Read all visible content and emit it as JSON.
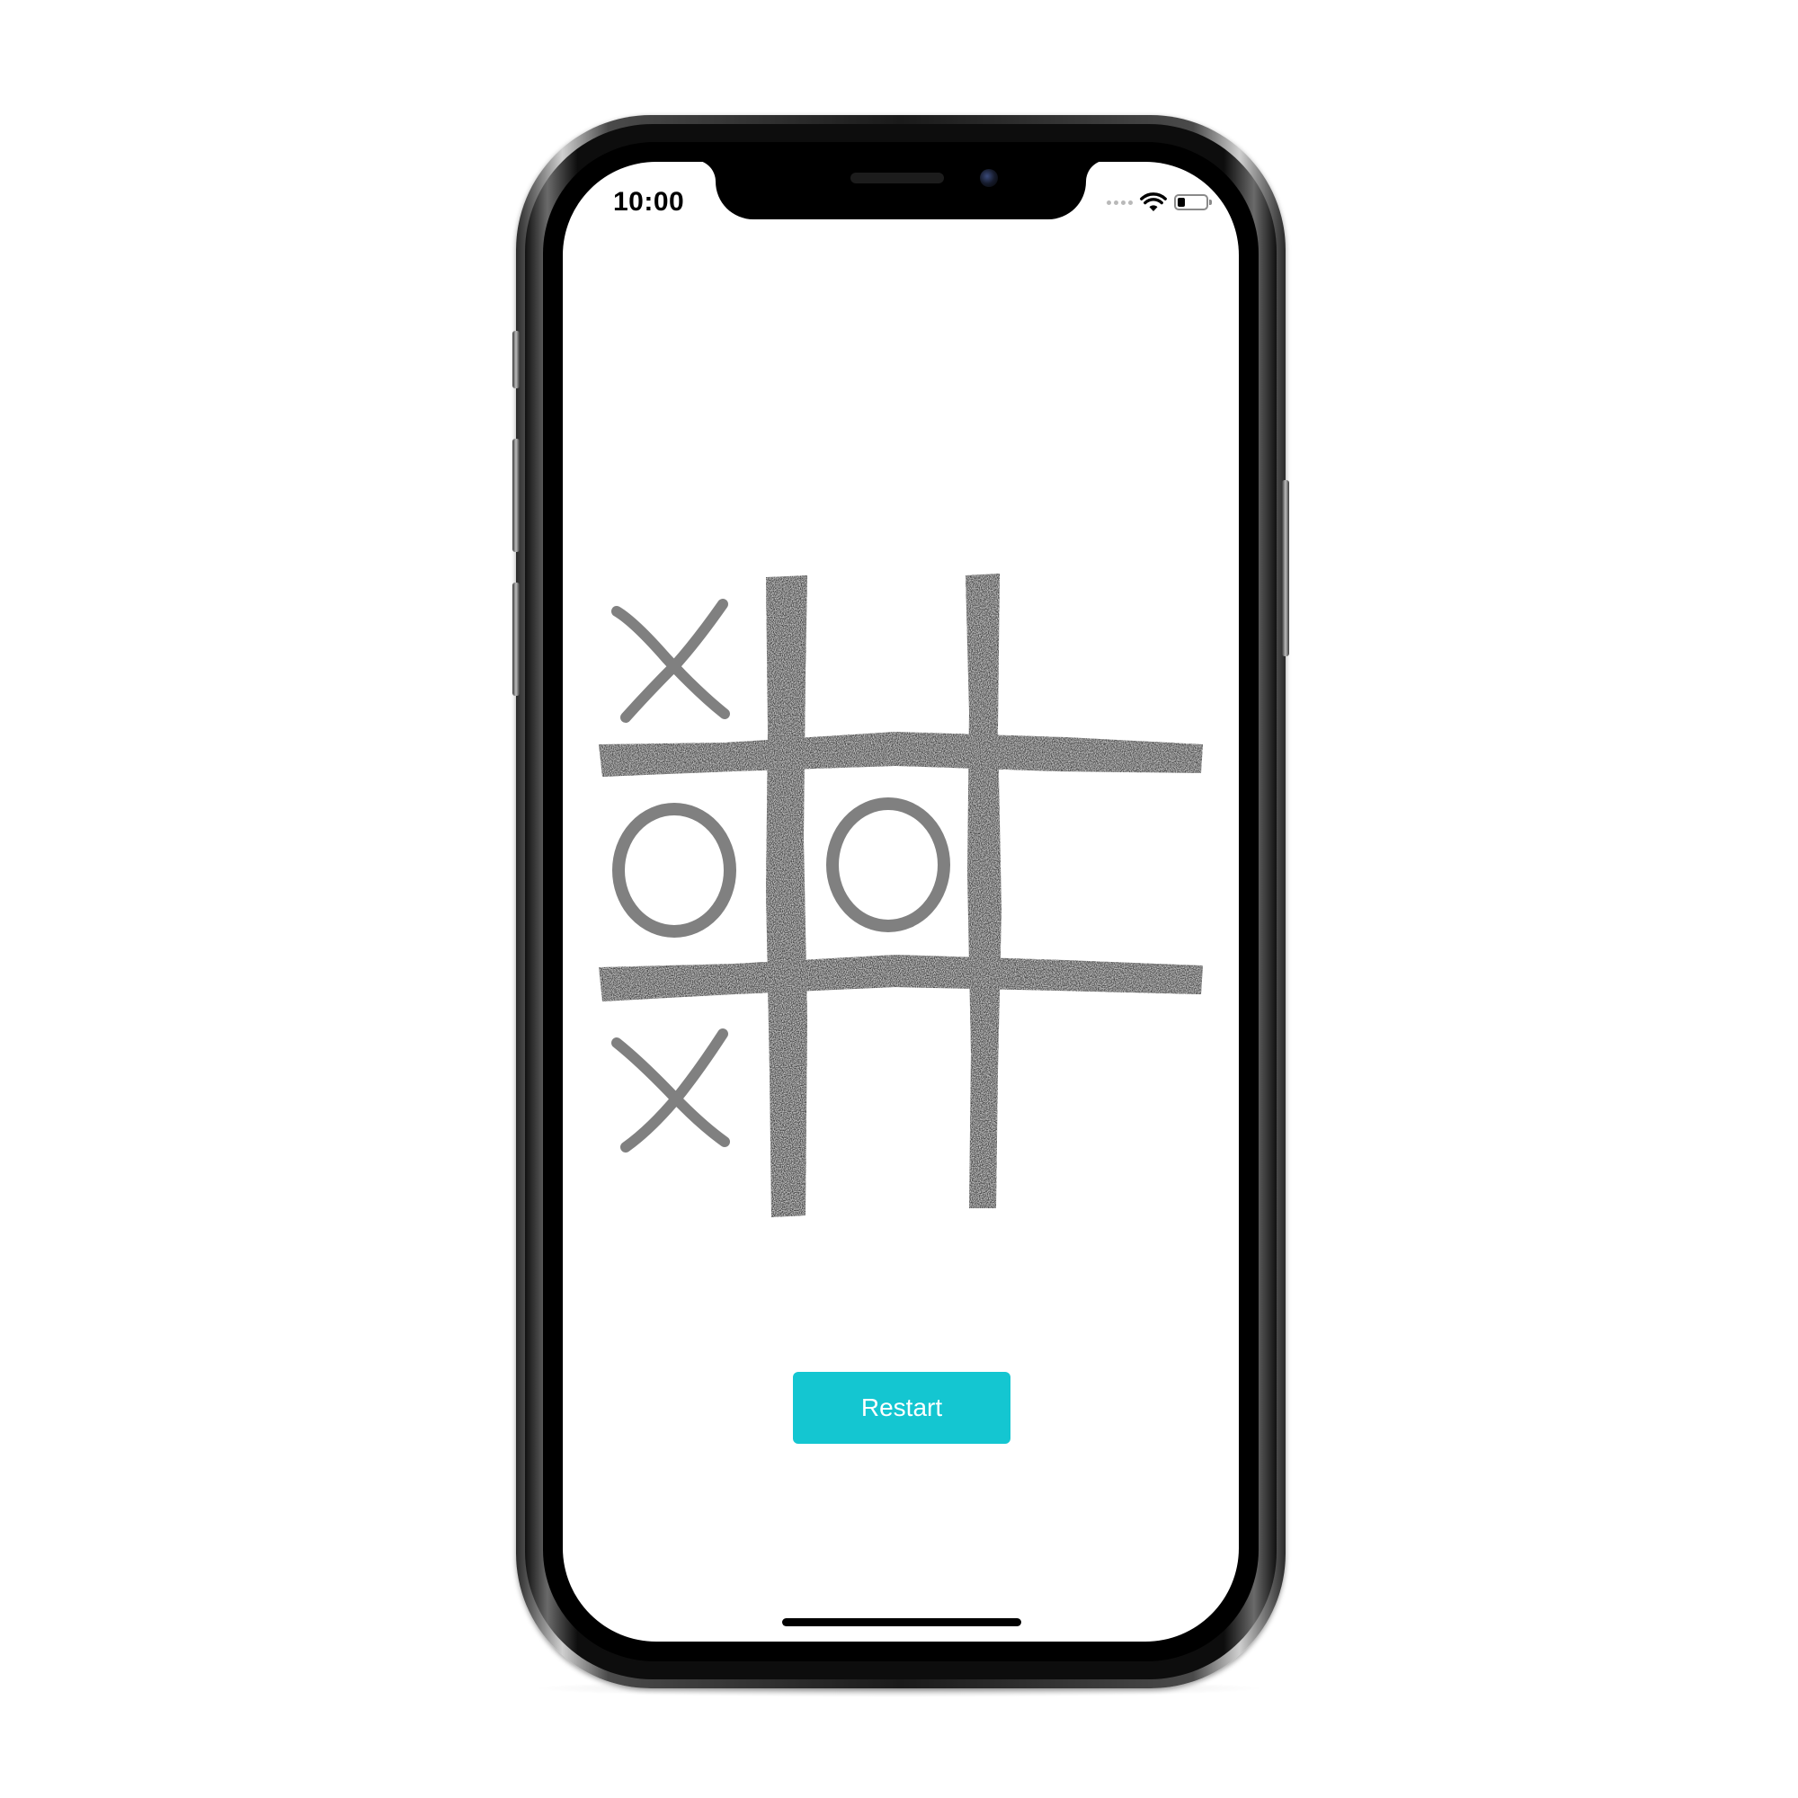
{
  "status_bar": {
    "time": "10:00",
    "icons": [
      "cellular-signal-icon",
      "wifi-icon",
      "battery-icon"
    ]
  },
  "game": {
    "board": [
      [
        "X",
        "",
        ""
      ],
      [
        "O",
        "O",
        ""
      ],
      [
        "X",
        "",
        ""
      ]
    ],
    "mark_color": "#808080",
    "grid_color": "#4a4a4a"
  },
  "restart_button": {
    "label": "Restart",
    "color": "#14c6d1"
  }
}
